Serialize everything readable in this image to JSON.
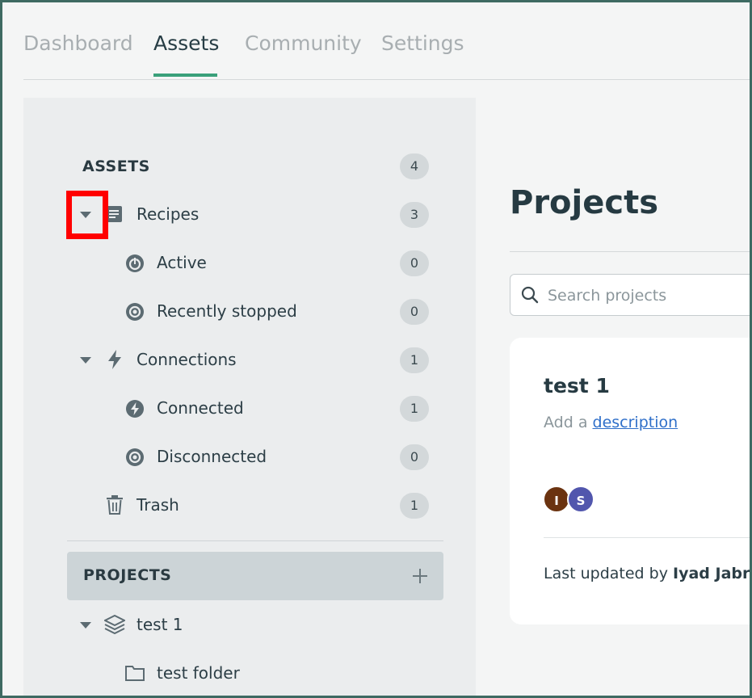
{
  "tabs": [
    {
      "label": "Dashboard"
    },
    {
      "label": "Assets"
    },
    {
      "label": "Community"
    },
    {
      "label": "Settings"
    }
  ],
  "active_tab": "Assets",
  "sidebar": {
    "assets_label": "ASSETS",
    "assets_count": "4",
    "recipes": {
      "label": "Recipes",
      "count": "3"
    },
    "active": {
      "label": "Active",
      "count": "0"
    },
    "recently_stopped": {
      "label": "Recently stopped",
      "count": "0"
    },
    "connections": {
      "label": "Connections",
      "count": "1"
    },
    "connected": {
      "label": "Connected",
      "count": "1"
    },
    "disconnected": {
      "label": "Disconnected",
      "count": "0"
    },
    "trash": {
      "label": "Trash",
      "count": "1"
    },
    "projects_label": "PROJECTS",
    "project": {
      "label": "test 1"
    },
    "folder": {
      "label": "test folder"
    }
  },
  "main": {
    "title": "Projects",
    "search_placeholder": "Search projects",
    "card": {
      "title": "test 1",
      "desc_prefix": "Add a",
      "desc_link": "description",
      "avatars": [
        {
          "initial": "I",
          "color": "#6b3310"
        },
        {
          "initial": "S",
          "color": "#5156ad"
        }
      ],
      "updated_prefix": "Last updated by",
      "updated_user": "Iyad Jabri"
    }
  },
  "colors": {
    "accent": "#3aa07a",
    "highlight": "#ff0000"
  }
}
